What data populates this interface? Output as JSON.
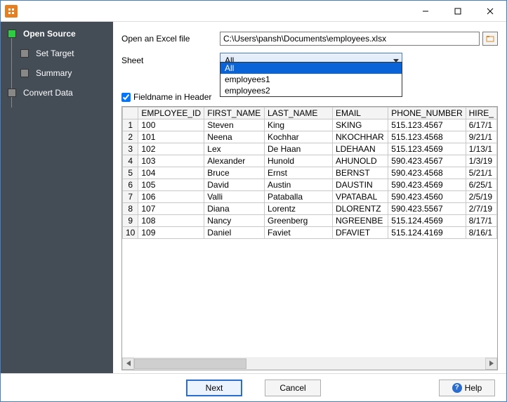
{
  "sidebar": {
    "items": [
      {
        "label": "Open Source",
        "active": true
      },
      {
        "label": "Set Target",
        "active": false
      },
      {
        "label": "Summary",
        "active": false
      },
      {
        "label": "Convert Data",
        "active": false
      }
    ]
  },
  "form": {
    "file_label": "Open an Excel file",
    "file_value": "C:\\Users\\pansh\\Documents\\employees.xlsx",
    "sheet_label": "Sheet",
    "sheet_selected": "All",
    "sheet_options": [
      "All",
      "employees1",
      "employees2"
    ],
    "fieldname_label": "Fieldname in Header",
    "fieldname_checked": true
  },
  "table": {
    "columns": [
      "EMPLOYEE_ID",
      "FIRST_NAME",
      "LAST_NAME",
      "EMAIL",
      "PHONE_NUMBER",
      "HIRE_"
    ],
    "rows": [
      {
        "n": "1",
        "c": [
          "100",
          "Steven",
          "King",
          "SKING",
          "515.123.4567",
          "6/17/1"
        ]
      },
      {
        "n": "2",
        "c": [
          "101",
          "Neena",
          "Kochhar",
          "NKOCHHAR",
          "515.123.4568",
          "9/21/1"
        ]
      },
      {
        "n": "3",
        "c": [
          "102",
          "Lex",
          "De Haan",
          "LDEHAAN",
          "515.123.4569",
          "1/13/1"
        ]
      },
      {
        "n": "4",
        "c": [
          "103",
          "Alexander",
          "Hunold",
          "AHUNOLD",
          "590.423.4567",
          "1/3/19"
        ]
      },
      {
        "n": "5",
        "c": [
          "104",
          "Bruce",
          "Ernst",
          "BERNST",
          "590.423.4568",
          "5/21/1"
        ]
      },
      {
        "n": "6",
        "c": [
          "105",
          "David",
          "Austin",
          "DAUSTIN",
          "590.423.4569",
          "6/25/1"
        ]
      },
      {
        "n": "7",
        "c": [
          "106",
          "Valli",
          "Pataballa",
          "VPATABAL",
          "590.423.4560",
          "2/5/19"
        ]
      },
      {
        "n": "8",
        "c": [
          "107",
          "Diana",
          "Lorentz",
          "DLORENTZ",
          "590.423.5567",
          "2/7/19"
        ]
      },
      {
        "n": "9",
        "c": [
          "108",
          "Nancy",
          "Greenberg",
          "NGREENBE",
          "515.124.4569",
          "8/17/1"
        ]
      },
      {
        "n": "10",
        "c": [
          "109",
          "Daniel",
          "Faviet",
          "DFAVIET",
          "515.124.4169",
          "8/16/1"
        ]
      }
    ]
  },
  "footer": {
    "next": "Next",
    "cancel": "Cancel",
    "help": "Help"
  }
}
